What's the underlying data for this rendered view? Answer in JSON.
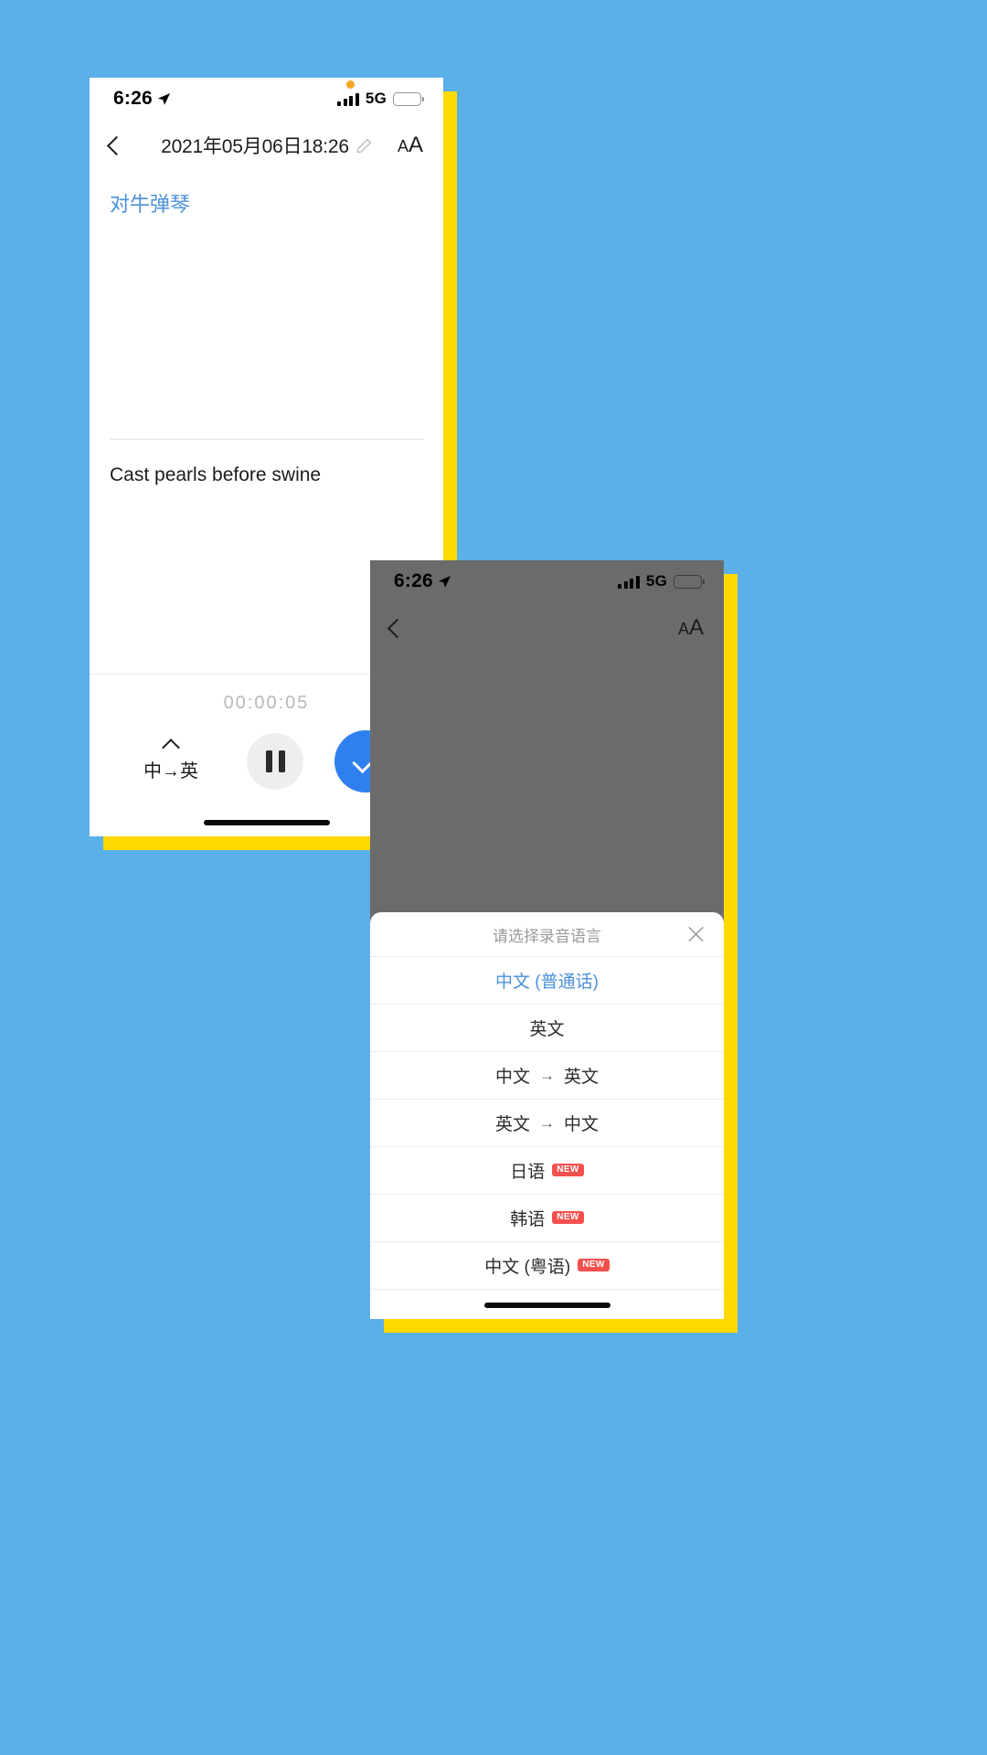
{
  "theme": {
    "background": "#5BB0E8",
    "shadow": "#FFD900",
    "accent_blue": "#2F80EE",
    "link_blue": "#4a90d9",
    "badge_red": "#F4514E",
    "dim_gray": "#6B6B6B"
  },
  "phone1": {
    "status": {
      "time": "6:26",
      "location_icon": "location-arrow-icon",
      "signal_icon": "signal-bars-icon",
      "network": "5G",
      "battery_icon": "battery-icon",
      "notification_dot": "orange-recording-dot"
    },
    "nav": {
      "back_icon": "chevron-left-icon",
      "title": "2021年05月06日18:26",
      "edit_icon": "pencil-icon",
      "textsize_small": "A",
      "textsize_large": "A"
    },
    "note": {
      "transcript_zh": "对牛弹琴",
      "transcript_en": "Cast pearls before swine"
    },
    "recorder": {
      "timer": "00:00:05",
      "language_label": "中→英",
      "caret_icon": "chevron-up-icon",
      "pause_icon": "pause-icon",
      "done_icon": "check-icon"
    },
    "home_indicator": "home-indicator"
  },
  "phone2": {
    "status": {
      "time": "6:26",
      "location_icon": "location-arrow-icon",
      "signal_icon": "signal-bars-icon",
      "network": "5G",
      "battery_icon": "battery-icon"
    },
    "nav": {
      "back_icon": "chevron-left-icon",
      "textsize_small": "A",
      "textsize_large": "A"
    },
    "sheet": {
      "title": "请选择录音语言",
      "close_icon": "close-icon",
      "options": [
        {
          "label": "中文 (普通话)",
          "selected": true,
          "badge": ""
        },
        {
          "label": "英文",
          "selected": false,
          "badge": ""
        },
        {
          "label": "中文",
          "arrow": "→",
          "label2": "英文",
          "selected": false,
          "badge": ""
        },
        {
          "label": "英文",
          "arrow": "→",
          "label2": "中文",
          "selected": false,
          "badge": ""
        },
        {
          "label": "日语",
          "selected": false,
          "badge": "NEW"
        },
        {
          "label": "韩语",
          "selected": false,
          "badge": "NEW"
        },
        {
          "label": "中文 (粤语)",
          "selected": false,
          "badge": "NEW"
        }
      ]
    },
    "home_indicator": "home-indicator"
  }
}
